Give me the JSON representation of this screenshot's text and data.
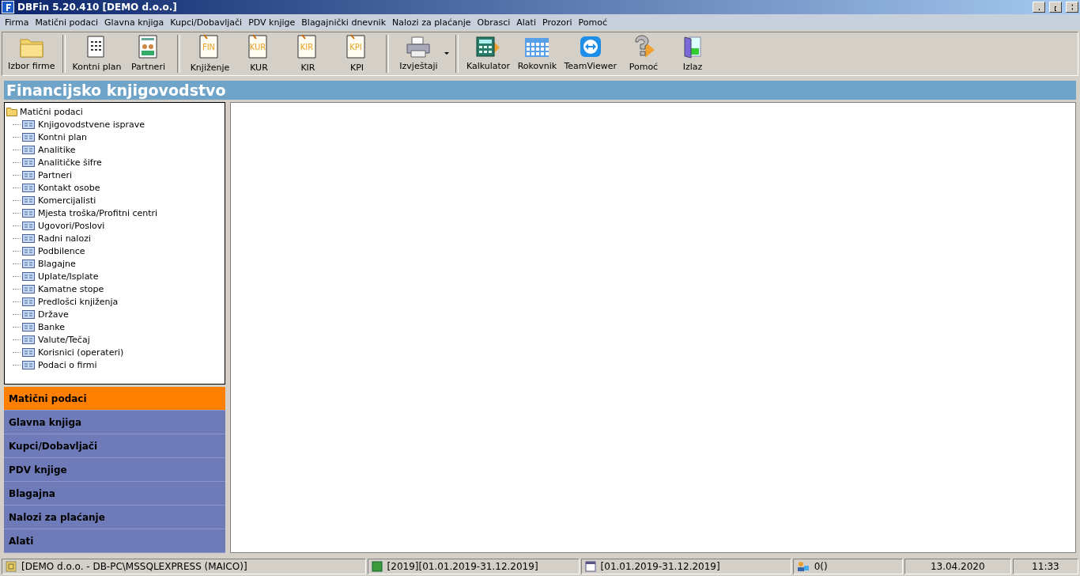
{
  "window": {
    "title": "DBFin 5.20.410 [DEMO d.o.o.]"
  },
  "menu": [
    "Firma",
    "Matični podaci",
    "Glavna knjiga",
    "Kupci/Dobavljači",
    "PDV knjige",
    "Blagajnički dnevnik",
    "Nalozi za plaćanje",
    "Obrasci",
    "Alati",
    "Prozori",
    "Pomoć"
  ],
  "toolbar": [
    [
      {
        "label": "Izbor firme",
        "kind": "folder"
      }
    ],
    [
      {
        "label": "Kontni plan",
        "kind": "doc"
      },
      {
        "label": "Partneri",
        "kind": "people"
      }
    ],
    [
      {
        "label": "Knjiženje",
        "kind": "tagdoc",
        "tag": "FIN"
      },
      {
        "label": "KUR",
        "kind": "tagdoc",
        "tag": "KUR"
      },
      {
        "label": "KIR",
        "kind": "tagdoc",
        "tag": "KIR"
      },
      {
        "label": "KPI",
        "kind": "tagdoc",
        "tag": "KPI"
      }
    ],
    [
      {
        "label": "Izvještaji",
        "kind": "printer",
        "dropdown": true
      }
    ],
    [
      {
        "label": "Kalkulator",
        "kind": "calculator"
      },
      {
        "label": "Rokovnik",
        "kind": "calendar"
      },
      {
        "label": "TeamViewer",
        "kind": "arrows"
      },
      {
        "label": "Pomoć",
        "kind": "help"
      },
      {
        "label": "Izlaz",
        "kind": "door"
      }
    ]
  ],
  "module_title": "Financijsko knjigovodstvo",
  "tree": {
    "label": "Matični podaci",
    "children": [
      {
        "label": "Knjigovodstvene isprave"
      },
      {
        "label": "Kontni plan"
      },
      {
        "label": "Analitike"
      },
      {
        "label": "Analitičke šifre"
      },
      {
        "label": "Partneri"
      },
      {
        "label": "Kontakt osobe"
      },
      {
        "label": "Komercijalisti"
      },
      {
        "label": "Mjesta troška/Profitni centri"
      },
      {
        "label": "Ugovori/Poslovi"
      },
      {
        "label": "Radni nalozi"
      },
      {
        "label": "Podbilence"
      },
      {
        "label": "Blagajne"
      },
      {
        "label": "Uplate/Isplate"
      },
      {
        "label": "Kamatne stope"
      },
      {
        "label": "Predlošci knjiženja"
      },
      {
        "label": "Države"
      },
      {
        "label": "Banke"
      },
      {
        "label": "Valute/Tečaj"
      },
      {
        "label": "Korisnici (operateri)"
      },
      {
        "label": "Podaci o firmi"
      }
    ]
  },
  "sections": [
    {
      "label": "Matični podaci",
      "selected": true
    },
    {
      "label": "Glavna knjiga",
      "selected": false
    },
    {
      "label": "Kupci/Dobavljači",
      "selected": false
    },
    {
      "label": "PDV knjige",
      "selected": false
    },
    {
      "label": "Blagajna",
      "selected": false
    },
    {
      "label": "Nalozi za plaćanje",
      "selected": false
    },
    {
      "label": "Alati",
      "selected": false
    }
  ],
  "status_bar": [
    {
      "text": "[DEMO d.o.o. - DB-PC\\MSSQLEXPRESS (MAICO)]",
      "kind": "db"
    },
    {
      "text": "[2019][01.01.2019-31.12.2019]",
      "kind": "book"
    },
    {
      "text": "[01.01.2019-31.12.2019]",
      "kind": "calendar"
    },
    {
      "text": "0()",
      "kind": "users"
    },
    {
      "text": "13.04.2020",
      "kind": "plain"
    },
    {
      "text": "11:33",
      "kind": "plain"
    }
  ]
}
